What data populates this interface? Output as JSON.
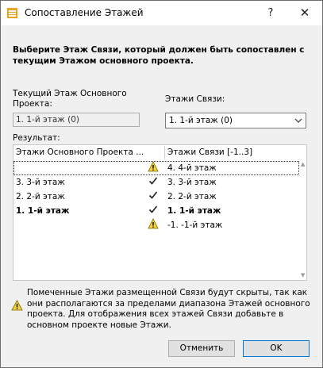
{
  "dialog": {
    "title": "Сопоставление Этажей",
    "help_glyph": "?",
    "close_glyph": "✕"
  },
  "instruction": "Выберите Этаж Связи, который должен быть сопоставлен с текущим Этажом основного проекта.",
  "current_story": {
    "label": "Текущий Этаж Основного Проекта:",
    "value": "1. 1-й этаж (0)"
  },
  "link_stories": {
    "label": "Этажи Связи:",
    "selected": "1. 1-й этаж (0)"
  },
  "result": {
    "label": "Результат:",
    "columns": {
      "host": "Этажи Основного Проекта ...",
      "link": "Этажи Связи [-1..3]"
    },
    "rows": [
      {
        "host": "",
        "status": "warning",
        "link": "4. 4-й этаж"
      },
      {
        "host": "3. 3-й этаж",
        "status": "check",
        "link": "3. 3-й этаж"
      },
      {
        "host": "2. 2-й этаж",
        "status": "check",
        "link": "2. 2-й этаж"
      },
      {
        "host": "1. 1-й этаж",
        "status": "check",
        "link": "1. 1-й этаж"
      },
      {
        "host": "",
        "status": "warning",
        "link": "-1. -1-й этаж"
      }
    ]
  },
  "note": "Помеченные Этажи размещенной Связи будут скрыты, так как они располагаются за пределами диапазона Этажей основного проекта. Для отображения всех этажей Связи добавьте в основном проекте новые Этажи.",
  "buttons": {
    "cancel": "Отменить",
    "ok": "OK"
  },
  "colors": {
    "warning_fill": "#f5d33a",
    "accent": "#0078d7"
  }
}
